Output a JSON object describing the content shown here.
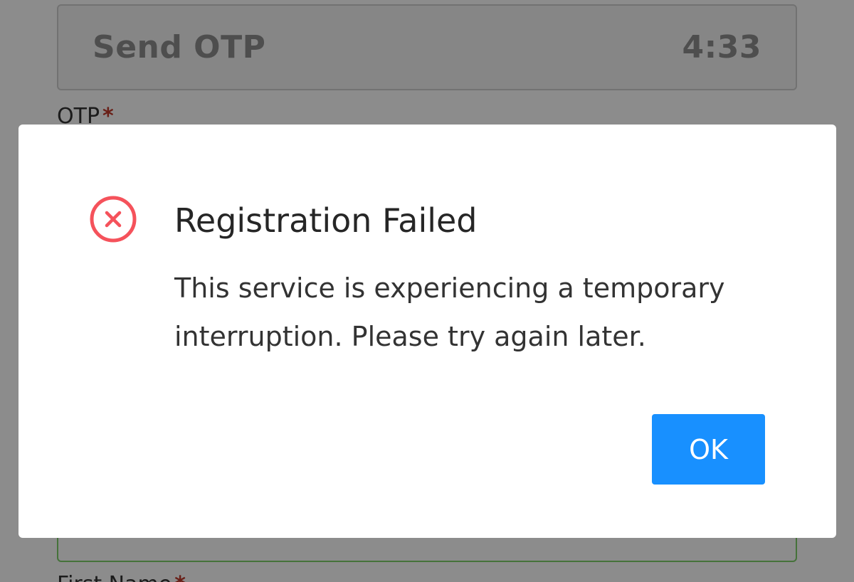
{
  "form": {
    "send_otp_label": "Send OTP",
    "countdown": "4:33",
    "otp_label": "OTP",
    "required_marker": "*",
    "first_name_label": "First Name",
    "accent_success_border": "#7fd06a"
  },
  "dialog": {
    "icon": "close-circle-icon",
    "icon_color": "#f5525b",
    "title": "Registration Failed",
    "message": "This service is experiencing a temporary interruption. Please try again later.",
    "ok_label": "OK",
    "ok_color": "#1890ff"
  }
}
